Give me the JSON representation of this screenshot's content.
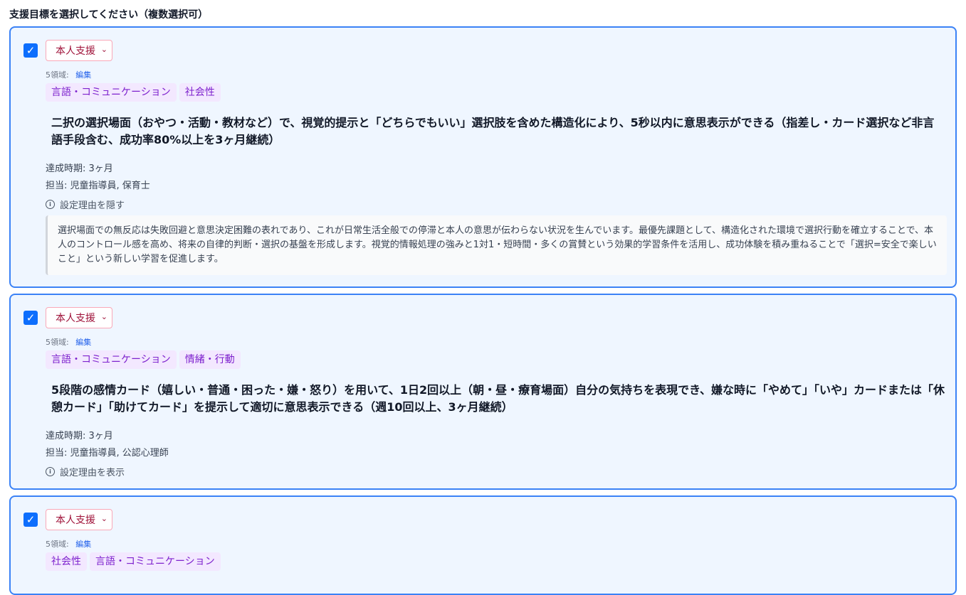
{
  "heading": "支援目標を選択してください（複数選択可）",
  "goals": [
    {
      "checked": true,
      "support_type": "本人支援",
      "domain_label": "5領域:",
      "edit_label": "編集",
      "tags": [
        "言語・コミュニケーション",
        "社会性"
      ],
      "text": "二択の選択場面（おやつ・活動・教材など）で、視覚的提示と「どちらでもいい」選択肢を含めた構造化により、5秒以内に意思表示ができる（指差し・カード選択など非言語手段含む、成功率80%以上を3ヶ月継続）",
      "period": "達成時期: 3ヶ月",
      "staff": "担当: 児童指導員, 保育士",
      "reason_toggle": "設定理由を隠す",
      "reason": "選択場面での無反応は失敗回避と意思決定困難の表れであり、これが日常生活全般での停滞と本人の意思が伝わらない状況を生んでいます。最優先課題として、構造化された環境で選択行動を確立することで、本人のコントロール感を高め、将来の自律的判断・選択の基盤を形成します。視覚的情報処理の強みと1対1・短時間・多くの賞賛という効果的学習条件を活用し、成功体験を積み重ねることで「選択=安全で楽しいこと」という新しい学習を促進します。"
    },
    {
      "checked": true,
      "support_type": "本人支援",
      "domain_label": "5領域:",
      "edit_label": "編集",
      "tags": [
        "言語・コミュニケーション",
        "情緒・行動"
      ],
      "text": "5段階の感情カード（嬉しい・普通・困った・嫌・怒り）を用いて、1日2回以上（朝・昼・療育場面）自分の気持ちを表現でき、嫌な時に「やめて」「いや」カードまたは「休憩カード」「助けてカード」を提示して適切に意思表示できる（週10回以上、3ヶ月継続）",
      "period": "達成時期: 3ヶ月",
      "staff": "担当: 児童指導員, 公認心理師",
      "reason_toggle": "設定理由を表示"
    },
    {
      "checked": true,
      "support_type": "本人支援",
      "domain_label": "5領域:",
      "edit_label": "編集",
      "tags": [
        "社会性",
        "言語・コミュニケーション"
      ]
    }
  ],
  "icons": {
    "check": "check-icon",
    "chevron": "chevron-down-icon",
    "info": "info-icon"
  },
  "colors": {
    "accent": "#3b82f6",
    "card_bg": "#eff6ff",
    "tag_bg": "#f3e8ff",
    "tag_text": "#7e22ce",
    "select_text": "#9f1239"
  }
}
